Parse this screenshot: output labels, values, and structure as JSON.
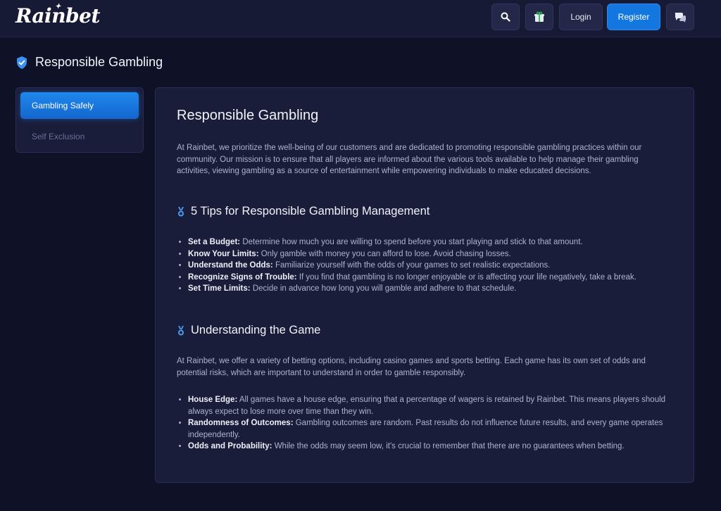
{
  "header": {
    "logo": "Rainbet",
    "search_icon": "search-icon",
    "gift_icon": "gift-icon",
    "login_label": "Login",
    "register_label": "Register",
    "chat_icon": "chat-icon",
    "accent_color": "#1477e0"
  },
  "page": {
    "title": "Responsible Gambling",
    "title_icon": "shield-check-icon"
  },
  "sidebar": {
    "items": [
      {
        "label": "Gambling Safely",
        "active": true
      },
      {
        "label": "Self Exclusion",
        "active": false
      }
    ]
  },
  "content": {
    "heading": "Responsible Gambling",
    "intro": "At Rainbet, we prioritize the well-being of our customers and are dedicated to promoting responsible gambling practices within our community. Our mission is to ensure that all players are informed about the various tools available to help manage their gambling activities, viewing gambling as a source of entertainment while empowering individuals to make educated decisions.",
    "section1": {
      "title": "5 Tips for Responsible Gambling Management",
      "items": [
        {
          "term": "Set a Budget:",
          "text": "Determine how much you are willing to spend before you start playing and stick to that amount."
        },
        {
          "term": "Know Your Limits:",
          "text": "Only gamble with money you can afford to lose. Avoid chasing losses."
        },
        {
          "term": "Understand the Odds:",
          "text": "Familiarize yourself with the odds of your games to set realistic expectations."
        },
        {
          "term": "Recognize Signs of Trouble:",
          "text": "If you find that gambling is no longer enjoyable or is affecting your life negatively, take a break."
        },
        {
          "term": "Set Time Limits:",
          "text": "Decide in advance how long you will gamble and adhere to that schedule."
        }
      ]
    },
    "section2": {
      "title": "Understanding the Game",
      "intro": "At Rainbet, we offer a variety of betting options, including casino games and sports betting. Each game has its own set of odds and potential risks, which are important to understand in order to gamble responsibly.",
      "items": [
        {
          "term": "House Edge:",
          "text": "All games have a house edge, ensuring that a percentage of wagers is retained by Rainbet. This means players should always expect to lose more over time than they win."
        },
        {
          "term": "Randomness of Outcomes:",
          "text": "Gambling outcomes are random. Past results do not influence future results, and every game operates independently."
        },
        {
          "term": "Odds and Probability:",
          "text": "While the odds may seem low, it's crucial to remember that there are no guarantees when betting."
        }
      ]
    }
  }
}
